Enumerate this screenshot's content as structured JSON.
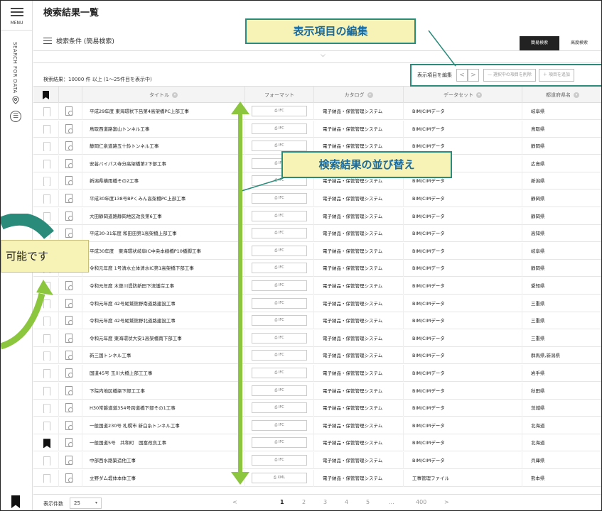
{
  "rail": {
    "menu_label": "MENU",
    "vertical_label": "SEARCH FOR DATA"
  },
  "header": {
    "title": "検索結果一覧",
    "condition_label": "検索条件 (簡易検索)",
    "mode_tabs": [
      "簡易検索",
      "高度検索"
    ]
  },
  "result_count": "検索結果：10000 件 以上 (1～25件目を表示中)",
  "toolbar": {
    "edit_columns_label": "表示項目を編集",
    "prev_col": "<",
    "next_col": ">",
    "remove_button": "— 選択中の項目を削除",
    "add_button": "＋ 項目を追加"
  },
  "columns": [
    "タイトル",
    "フォーマット",
    "カタログ",
    "データセット",
    "都道府県名"
  ],
  "rows": [
    {
      "bookmarked": false,
      "title": "平成29年度 東海環状下呂第4高架橋PC上部工事",
      "format": "IFC",
      "catalog": "電子納品・保管管理システム",
      "dataset": "BIM/CIMデータ",
      "pref": "岐阜県"
    },
    {
      "bookmarked": false,
      "title": "鳥取西道路富山トンネル工事",
      "format": "IFC",
      "catalog": "電子納品・保管管理システム",
      "dataset": "BIM/CIMデータ",
      "pref": "鳥取県"
    },
    {
      "bookmarked": false,
      "title": "静岡仁泉道路五十鈴トンネル工事",
      "format": "IFC",
      "catalog": "電子納品・保管管理システム",
      "dataset": "BIM/CIMデータ",
      "pref": "静岡県"
    },
    {
      "bookmarked": false,
      "title": "安芸バイパス寺分高架橋第2下部工事",
      "format": "IFC",
      "catalog": "電子納品・保管管理システム",
      "dataset": "BIM/CIMデータ",
      "pref": "広島県"
    },
    {
      "bookmarked": false,
      "title": "新潟県横雨橋その2工事",
      "format": "IFC",
      "catalog": "電子納品・保管管理システム",
      "dataset": "BIM/CIMデータ",
      "pref": "新潟県"
    },
    {
      "bookmarked": false,
      "title": "平成30年度138号BPくみん高架橋PC上部工事",
      "format": "IFC",
      "catalog": "電子納品・保管管理システム",
      "dataset": "BIM/CIMデータ",
      "pref": "静岡県"
    },
    {
      "bookmarked": false,
      "title": "大田静岡道路静岡地区改良第6工事",
      "format": "IFC",
      "catalog": "電子納品・保管管理システム",
      "dataset": "BIM/CIMデータ",
      "pref": "静岡県"
    },
    {
      "bookmarked": false,
      "title": "平成30-31年度 和田田第1高架橋上部工事",
      "format": "IFC",
      "catalog": "電子納品・保管管理システム",
      "dataset": "BIM/CIMデータ",
      "pref": "高知県"
    },
    {
      "bookmarked": false,
      "title": "平成30年度　東海環状岐阜IC中央本線橋P10橋脚工事",
      "format": "IFC",
      "catalog": "電子納品・保管管理システム",
      "dataset": "BIM/CIMデータ",
      "pref": "岐阜県"
    },
    {
      "bookmarked": false,
      "title": "令和元年度 1号清水立体清水IC第1高架橋下部工事",
      "format": "IFC",
      "catalog": "電子納品・保管管理システム",
      "dataset": "BIM/CIMデータ",
      "pref": "静岡県"
    },
    {
      "bookmarked": false,
      "title": "令和元年度 木曽川堤防新田下流護岸工事",
      "format": "IFC",
      "catalog": "電子納品・保管管理システム",
      "dataset": "BIM/CIMデータ",
      "pref": "愛知県"
    },
    {
      "bookmarked": false,
      "title": "令和元年度 42号尾鷲熊野南道路建設工事",
      "format": "IFC",
      "catalog": "電子納品・保管管理システム",
      "dataset": "BIM/CIMデータ",
      "pref": "三重県"
    },
    {
      "bookmarked": false,
      "title": "令和元年度 42号尾鷲熊野北道路建設工事",
      "format": "IFC",
      "catalog": "電子納品・保管管理システム",
      "dataset": "BIM/CIMデータ",
      "pref": "三重県"
    },
    {
      "bookmarked": false,
      "title": "令和元年度 東海環状大安1高架橋南下部工事",
      "format": "IFC",
      "catalog": "電子納品・保管管理システム",
      "dataset": "BIM/CIMデータ",
      "pref": "三重県"
    },
    {
      "bookmarked": false,
      "title": "新三国トンネル工事",
      "format": "IFC",
      "catalog": "電子納品・保管管理システム",
      "dataset": "BIM/CIMデータ",
      "pref": "群馬県,新潟県"
    },
    {
      "bookmarked": false,
      "title": "国道45号 玉川大橋上部工工事",
      "format": "IFC",
      "catalog": "電子納品・保管管理システム",
      "dataset": "BIM/CIMデータ",
      "pref": "岩手県"
    },
    {
      "bookmarked": false,
      "title": "下院内地区橋梁下部工工事",
      "format": "IFC",
      "catalog": "電子納品・保管管理システム",
      "dataset": "BIM/CIMデータ",
      "pref": "秋田県"
    },
    {
      "bookmarked": false,
      "title": "H30常磐道道354号跨道橋下部その1工事",
      "format": "IFC",
      "catalog": "電子納品・保管管理システム",
      "dataset": "BIM/CIMデータ",
      "pref": "茨城県"
    },
    {
      "bookmarked": false,
      "title": "一般国道230号 札幌市 新白糸トンネル工事",
      "format": "IFC",
      "catalog": "電子納品・保管管理システム",
      "dataset": "BIM/CIMデータ",
      "pref": "北海道"
    },
    {
      "bookmarked": true,
      "title": "一般国道5号　共和町　国富改良工事",
      "format": "IFC",
      "catalog": "電子納品・保管管理システム",
      "dataset": "BIM/CIMデータ",
      "pref": "北海道"
    },
    {
      "bookmarked": false,
      "title": "中部西水路築造他工事",
      "format": "IFC",
      "catalog": "電子納品・保管管理システム",
      "dataset": "BIM/CIMデータ",
      "pref": "兵庫県"
    },
    {
      "bookmarked": false,
      "title": "立野ダム堤体本体工事",
      "format": "XML",
      "catalog": "電子納品・保管管理システム",
      "dataset": "工事管理ファイル",
      "pref": "熊本県"
    }
  ],
  "footer": {
    "per_page_label": "表示件数",
    "per_page_value": "25",
    "pages": [
      "<",
      "1",
      "2",
      "3",
      "4",
      "5",
      "...",
      "400",
      ">"
    ]
  },
  "annotations": {
    "edit_columns": "表示項目の編集",
    "sort_results": "検索結果の並び替え",
    "left_note": "可能です"
  },
  "colors": {
    "callout_bg": "#f7f2b5",
    "callout_border": "#2a8b7a",
    "callout_text": "#1a6a9c",
    "arrow_green": "#8cc63f"
  }
}
